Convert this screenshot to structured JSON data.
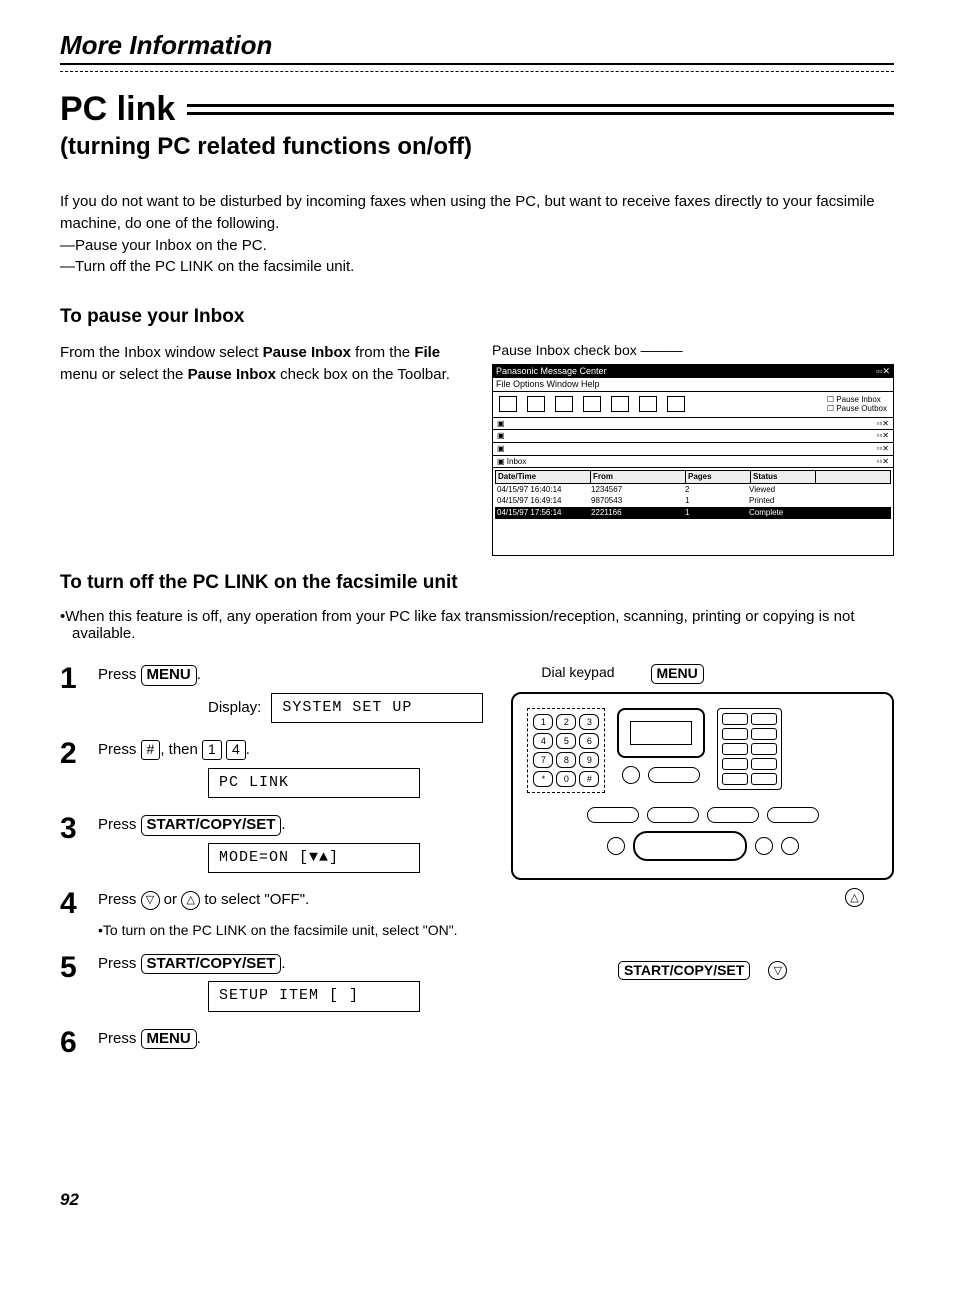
{
  "header": "More Information",
  "title": "PC link",
  "subtitle": "(turning PC related functions on/off)",
  "intro": {
    "p1": "If you do not want to be disturbed by incoming faxes when using the PC, but want to receive faxes directly to your facsimile machine, do one of the following.",
    "l1": "—Pause your Inbox on the PC.",
    "l2": "—Turn off the PC LINK on the facsimile unit."
  },
  "section1": {
    "heading": "To pause your Inbox",
    "text_prefix": "From the Inbox window select ",
    "bold1": "Pause Inbox",
    "text_mid": " from the ",
    "bold2": "File",
    "text_mid2": " menu or select the ",
    "bold3": "Pause Inbox",
    "text_suffix": " check box on the Toolbar.",
    "caption": "Pause Inbox check box",
    "window": {
      "title": "Panasonic Message Center",
      "menus": "File  Options  Window  Help",
      "check1": "Pause Inbox",
      "check2": "Pause Outbox",
      "sub_inbox": "Inbox",
      "col_date": "Date/Time",
      "col_from": "From",
      "col_pages": "Pages",
      "col_status": "Status",
      "row1": {
        "c1": "04/15/97   16:40:14",
        "c2": "1234567",
        "c3": "2",
        "c4": "Viewed"
      },
      "row2": {
        "c1": "04/15/97   16:49:14",
        "c2": "9870543",
        "c3": "1",
        "c4": "Printed"
      },
      "row3": {
        "c1": "04/15/97   17:56:14",
        "c2": "2221166",
        "c3": "1",
        "c4": "Complete"
      }
    }
  },
  "section2": {
    "heading": "To turn off the PC LINK on the facsimile unit",
    "note": "•When this feature is off, any operation from your PC like fax transmission/reception, scanning, printing or copying is not available."
  },
  "steps": {
    "s1": {
      "num": "1",
      "prefix": "Press ",
      "btn": "MENU",
      "suffix": ".",
      "disp_label": "Display:",
      "lcd": "SYSTEM SET UP"
    },
    "s2": {
      "num": "2",
      "prefix": "Press ",
      "k1": "#",
      "mid": ", then ",
      "k2": "1",
      "k3": "4",
      "suffix": ".",
      "lcd": "PC LINK"
    },
    "s3": {
      "num": "3",
      "prefix": "Press ",
      "btn": "START/COPY/SET",
      "suffix": ".",
      "lcd": "MODE=ON     [▼▲]"
    },
    "s4": {
      "num": "4",
      "prefix": "Press ",
      "mid": " or ",
      "suffix": " to select \"OFF\".",
      "sub": "•To turn on the PC LINK on the facsimile unit, select \"ON\"."
    },
    "s5": {
      "num": "5",
      "prefix": "Press ",
      "btn": "START/COPY/SET",
      "suffix": ".",
      "lcd": "SETUP ITEM [   ]"
    },
    "s6": {
      "num": "6",
      "prefix": "Press ",
      "btn": "MENU",
      "suffix": "."
    }
  },
  "fax": {
    "label1": "Dial keypad",
    "label2": "MENU",
    "bottom_btn": "START/COPY/SET",
    "down": "▽",
    "up": "△",
    "keys": [
      "1",
      "2",
      "3",
      "4",
      "5",
      "6",
      "7",
      "8",
      "9",
      "*",
      "0",
      "#"
    ]
  },
  "pagenum": "92"
}
